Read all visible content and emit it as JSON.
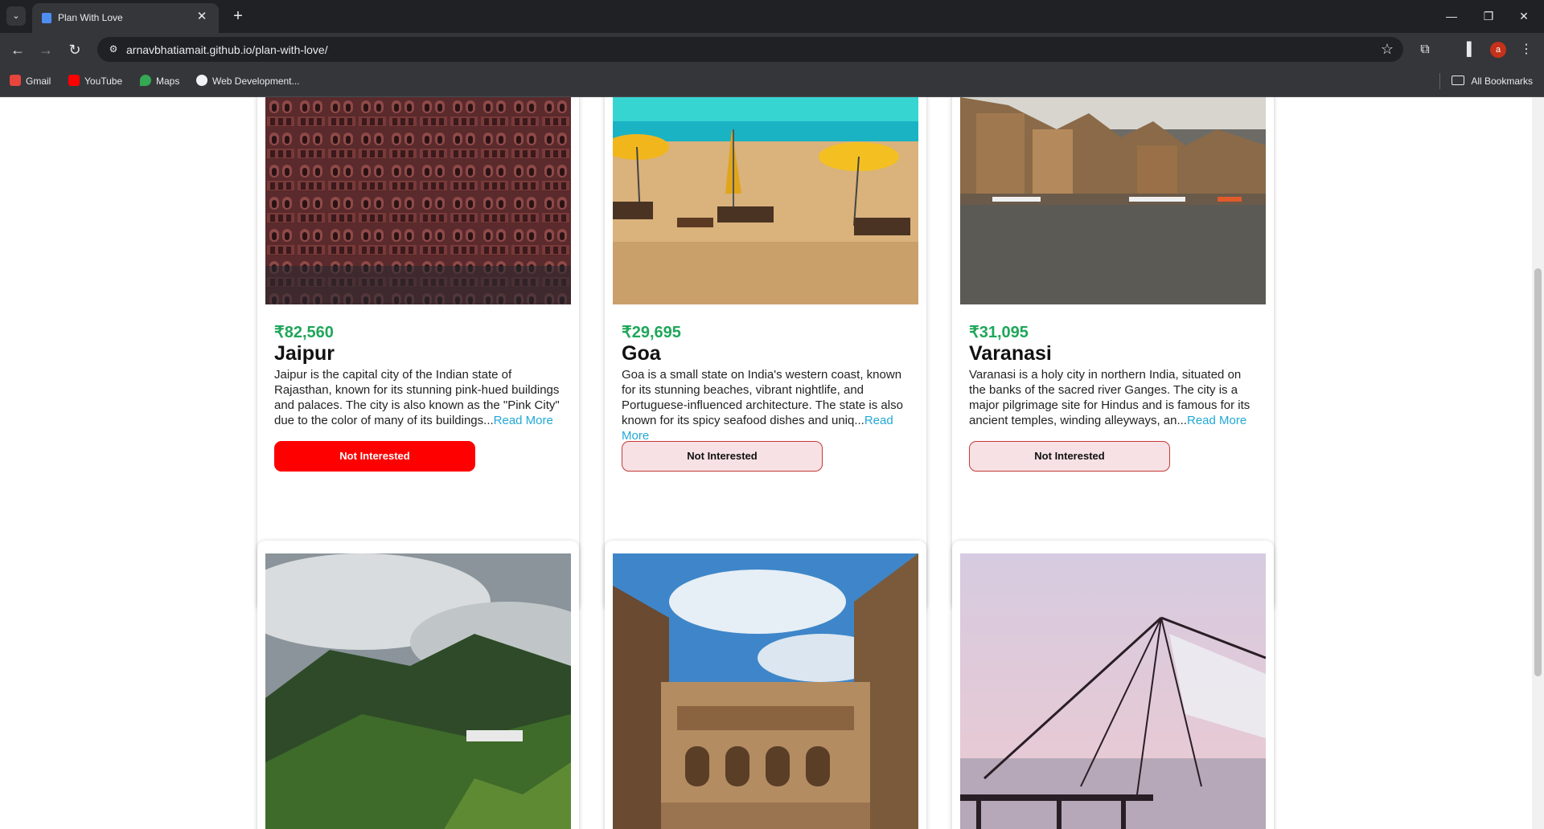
{
  "browser": {
    "tab_title": "Plan With Love",
    "url": "arnavbhatiamait.github.io/plan-with-love/",
    "profile_initial": "a",
    "bookmarks": [
      "Gmail",
      "YouTube",
      "Maps",
      "Web Development..."
    ],
    "all_bookmarks": "All Bookmarks"
  },
  "tours": [
    {
      "price": "₹82,560",
      "name": "Jaipur",
      "description": "Jaipur is the capital city of the Indian state of Rajasthan, known for its stunning pink-hued buildings and palaces. The city is also known as the \"Pink City\" due to the color of many of its buildings...",
      "read_more": "Read More",
      "button": "Not Interested",
      "button_state": "active"
    },
    {
      "price": "₹29,695",
      "name": "Goa",
      "description": "Goa is a small state on India's western coast, known for its stunning beaches, vibrant nightlife, and Portuguese-influenced architecture. The state is also known for its spicy seafood dishes and uniq...",
      "read_more": "Read More",
      "button": "Not Interested",
      "button_state": "default"
    },
    {
      "price": "₹31,095",
      "name": "Varanasi",
      "description": "Varanasi is a holy city in northern India, situated on the banks of the sacred river Ganges. The city is a major pilgrimage site for Hindus and is famous for its ancient temples, winding alleyways, an...",
      "read_more": "Read More",
      "button": "Not Interested",
      "button_state": "default"
    }
  ],
  "colors": {
    "price": "#1fa65a",
    "read_more": "#22a8d6",
    "button_active": "#fe0000",
    "button_default": "#f7e1e4"
  }
}
